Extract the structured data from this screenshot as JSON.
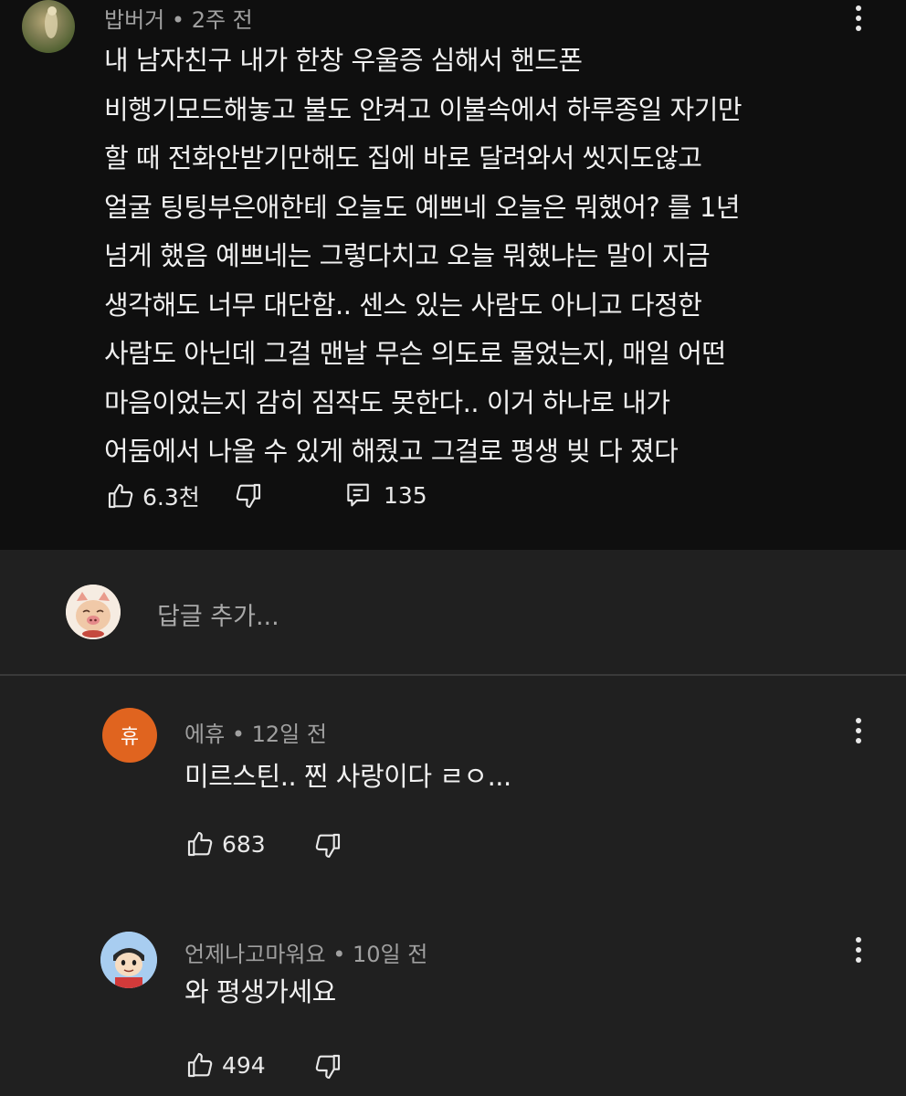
{
  "top_comment": {
    "author": "밥버거",
    "separator": "•",
    "time": "2주 전",
    "lines": [
      "내 남자친구 내가 한창 우울증 심해서 핸드폰",
      "비행기모드해놓고 불도 안켜고 이불속에서 하루종일 자기만",
      "할 때 전화안받기만해도 집에 바로 달려와서 씻지도않고",
      "얼굴 팅팅부은애한테 오늘도 예쁘네 오늘은 뭐했어? 를 1년",
      "넘게 했음 예쁘네는 그렇다치고 오늘 뭐했냐는 말이 지금",
      "생각해도 너무 대단함.. 센스 있는 사람도 아니고 다정한",
      "사람도 아닌데 그걸 맨날 무슨 의도로 물었는지, 매일 어떤",
      "마음이었는지 감히 짐작도 못한다..  이거 하나로 내가",
      "어둠에서 나올 수 있게 해줬고 그걸로 평생 빚 다 졌다"
    ],
    "likes": "6.3천",
    "replies_count": "135"
  },
  "reply_box": {
    "placeholder": "답글 추가..."
  },
  "replies": [
    {
      "author": "에휴",
      "separator": "•",
      "time": "12일 전",
      "avatar_letter": "휴",
      "text": "미르스틴.. 찐 사랑이다 ㄹㅇ...",
      "likes": "683"
    },
    {
      "author": "언제나고마워요",
      "separator": "•",
      "time": "10일 전",
      "text": "와 평생가세요",
      "likes": "494"
    }
  ],
  "colors": {
    "top_bg": "#0f0f0f",
    "section_bg": "#202020",
    "reply_avatar_orange": "#e0641f"
  }
}
